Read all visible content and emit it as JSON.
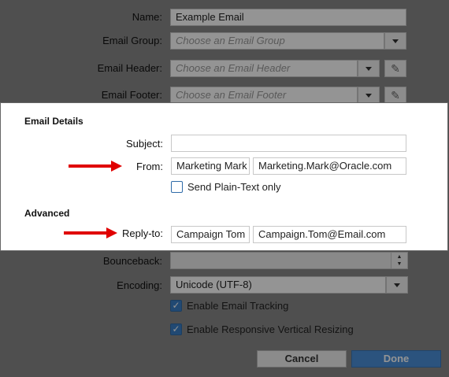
{
  "top": {
    "name_label": "Name:",
    "name_value": "Example Email",
    "group_label": "Email Group:",
    "group_placeholder": "Choose an Email Group",
    "header_label": "Email Header:",
    "header_placeholder": "Choose an Email Header",
    "footer_label": "Email Footer:",
    "footer_placeholder": "Choose an Email Footer"
  },
  "details": {
    "title": "Email Details",
    "subject_label": "Subject:",
    "subject_value": "",
    "from_label": "From:",
    "from_name": "Marketing Mark",
    "from_email": "Marketing.Mark@Oracle.com",
    "plaintext_label": "Send Plain-Text only"
  },
  "advanced": {
    "title": "Advanced",
    "replyto_label": "Reply-to:",
    "replyto_name": "Campaign Tom",
    "replyto_email": "Campaign.Tom@Email.com"
  },
  "bottom": {
    "bounceback_label": "Bounceback:",
    "encoding_label": "Encoding:",
    "encoding_value": "Unicode (UTF-8)",
    "tracking_label": "Enable Email Tracking",
    "resizing_label": "Enable Responsive Vertical Resizing",
    "cancel_label": "Cancel",
    "done_label": "Done"
  },
  "colors": {
    "arrow": "#e00000",
    "done_button": "#4a90d9",
    "checkbox": "#3a7ec6"
  }
}
